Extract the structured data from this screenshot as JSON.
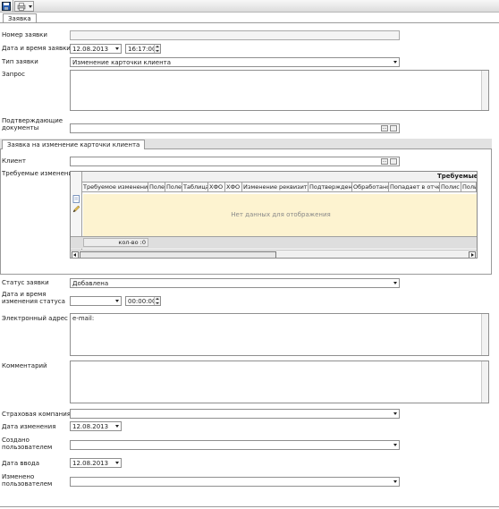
{
  "tab": {
    "label": "Заявка"
  },
  "fields": {
    "request_number": {
      "label": "Номер заявки",
      "value": ""
    },
    "datetime": {
      "label": "Дата и время заявки",
      "date": "12.08.2013",
      "time": "16:17:00"
    },
    "request_type": {
      "label": "Тип заявки",
      "value": "Изменение карточки клиента"
    },
    "request": {
      "label": "Запрос",
      "value": ""
    },
    "confirm_docs": {
      "label_line1": "Подтверждающие",
      "label_line2": "документы",
      "value": "",
      "dots": "..."
    }
  },
  "inner_tab": {
    "label": "Заявка на изменение карточки клиента",
    "client": {
      "label": "Клиент",
      "value": "",
      "dots": "..."
    },
    "required_changes": {
      "label": "Требуемые изменения"
    },
    "grid": {
      "band_header": "Требуемые и",
      "columns": [
        "Требуемое изменение",
        "Поле",
        "Поле",
        "Таблица",
        "ХФО",
        "ХФО",
        "Изменение реквизита",
        "Подтверждено",
        "Обработано",
        "Попадает в отчет",
        "Полис",
        "Полис"
      ],
      "empty_text": "Нет данных для отображения",
      "footer_count": "кол-во :0"
    }
  },
  "status": {
    "label": "Статус заявки",
    "value": "Добавлена",
    "change_label_line1": "Дата и время",
    "change_label_line2": "изменения статуса",
    "change_date": "",
    "change_time": "00:00:00"
  },
  "email": {
    "label": "Электронный адрес",
    "value": "e-mail:"
  },
  "comment": {
    "label": "Комментарий",
    "value": ""
  },
  "insurer": {
    "label": "Страховая компания",
    "value": ""
  },
  "change_date": {
    "label": "Дата изменения",
    "value": "12.08.2013"
  },
  "created_by": {
    "label_line1": "Создано",
    "label_line2": "пользователем",
    "value": ""
  },
  "input_date": {
    "label": "Дата ввода",
    "value": "12.08.2013"
  },
  "modified_by": {
    "label_line1": "Изменено",
    "label_line2": "пользователем",
    "value": ""
  }
}
